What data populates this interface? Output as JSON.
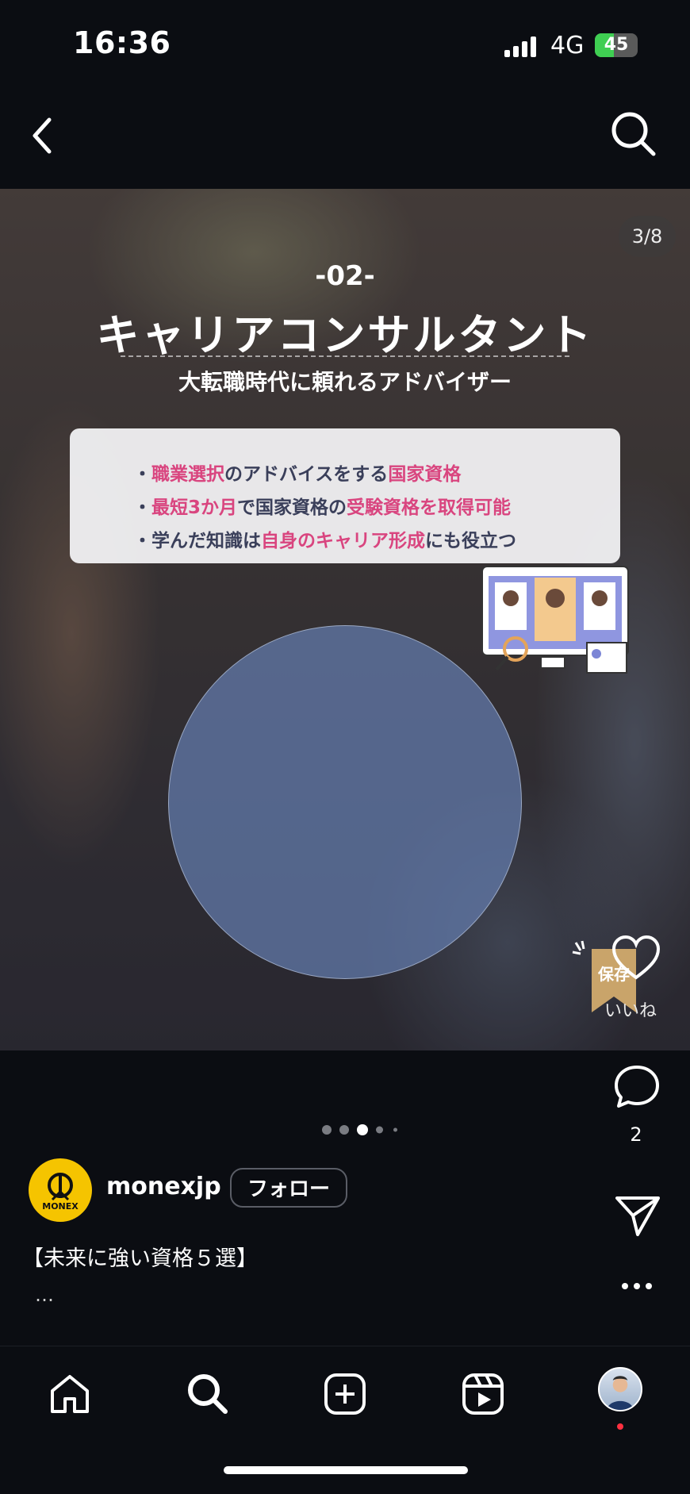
{
  "status_bar": {
    "time": "16:36",
    "network": "4G",
    "battery": "45"
  },
  "post": {
    "counter": "3/8",
    "slide_number": "-02-",
    "title": "キャリアコンサルタント",
    "subtitle": "大転職時代に頼れるアドバイザー",
    "bullets": [
      {
        "parts": [
          "・",
          "職業選択",
          "のアドバイスをする",
          "国家資格"
        ]
      },
      {
        "parts": [
          "・",
          "最短3か月",
          "で国家資格の",
          "受験資格を取得可能"
        ]
      },
      {
        "parts": [
          "・学んだ知識は",
          "自身のキャリア形成",
          "にも役立つ"
        ]
      }
    ],
    "save_label": "保存",
    "like_label": "いいね"
  },
  "actions": {
    "comment_count": "2"
  },
  "carousel": {
    "count": 5,
    "active_index": 2
  },
  "account": {
    "username": "monexjp",
    "avatar_text": "MONEX",
    "follow_label": "フォロー"
  },
  "caption": {
    "text": "【未来に強い資格５選】",
    "more": "…"
  },
  "colors": {
    "background": "#0b0d12",
    "highlight": "#d9457f",
    "card": "#f5f5f8",
    "circle": "#647db0",
    "brand_yellow": "#f5c400"
  }
}
